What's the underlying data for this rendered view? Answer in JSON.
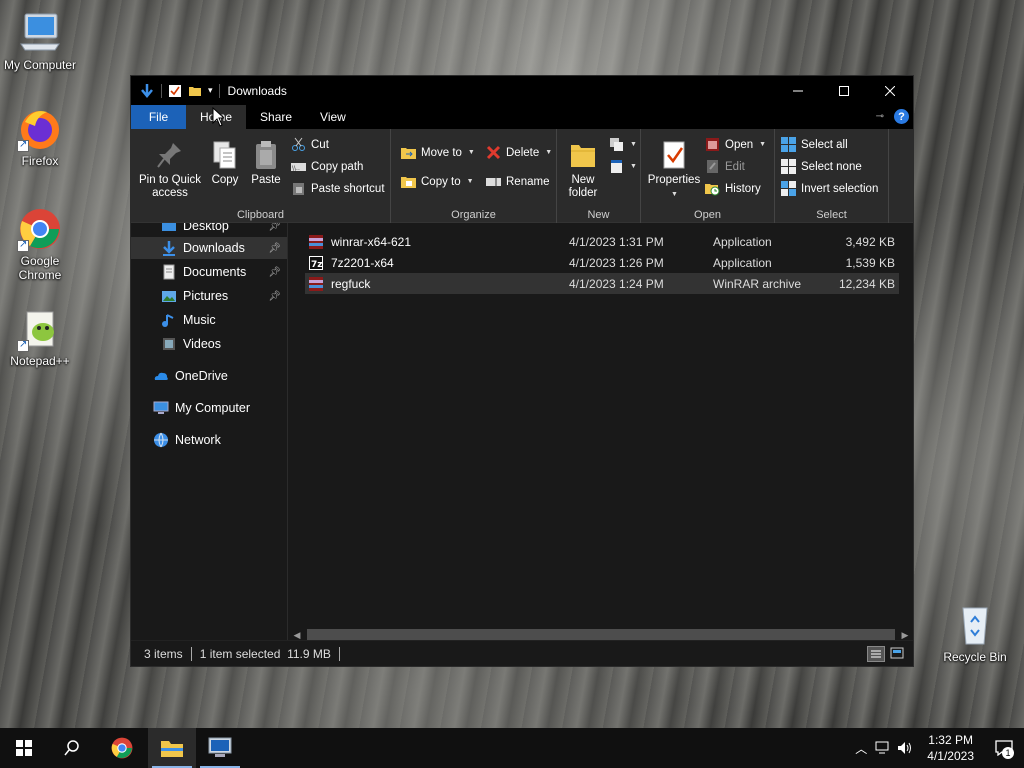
{
  "desktop": {
    "icons": [
      {
        "label": "My Computer",
        "icon": "computer-icon"
      },
      {
        "label": "Firefox",
        "icon": "firefox-icon"
      },
      {
        "label": "Google Chrome",
        "icon": "chrome-icon"
      },
      {
        "label": "Notepad++",
        "icon": "notepadpp-icon"
      },
      {
        "label": "Recycle Bin",
        "icon": "recycle-bin-icon"
      }
    ]
  },
  "window": {
    "title": "Downloads",
    "tabs": [
      {
        "label": "File"
      },
      {
        "label": "Home"
      },
      {
        "label": "Share"
      },
      {
        "label": "View"
      }
    ],
    "ribbon": {
      "clipboard": {
        "label": "Clipboard",
        "pin": "Pin to Quick access",
        "copy": "Copy",
        "paste": "Paste",
        "cut": "Cut",
        "copy_path": "Copy path",
        "paste_shortcut": "Paste shortcut"
      },
      "organize": {
        "label": "Organize",
        "move_to": "Move to",
        "copy_to": "Copy to",
        "delete": "Delete",
        "rename": "Rename"
      },
      "new": {
        "label": "New",
        "new_folder": "New folder"
      },
      "open": {
        "label": "Open",
        "properties": "Properties",
        "open": "Open",
        "edit": "Edit",
        "history": "History"
      },
      "select": {
        "label": "Select",
        "select_all": "Select all",
        "select_none": "Select none",
        "invert": "Invert selection"
      }
    },
    "nav": {
      "items": [
        {
          "label": "Desktop",
          "pinned": true
        },
        {
          "label": "Downloads",
          "pinned": true,
          "selected": true
        },
        {
          "label": "Documents",
          "pinned": true
        },
        {
          "label": "Pictures",
          "pinned": true
        },
        {
          "label": "Music"
        },
        {
          "label": "Videos"
        },
        {
          "label": "OneDrive"
        },
        {
          "label": "My Computer"
        },
        {
          "label": "Network"
        }
      ]
    },
    "files": [
      {
        "name": "winrar-x64-621",
        "date": "4/1/2023 1:31 PM",
        "type": "Application",
        "size": "3,492 KB"
      },
      {
        "name": "7z2201-x64",
        "date": "4/1/2023 1:26 PM",
        "type": "Application",
        "size": "1,539 KB"
      },
      {
        "name": "regfuck",
        "date": "4/1/2023 1:24 PM",
        "type": "WinRAR archive",
        "size": "12,234 KB",
        "selected": true
      }
    ],
    "status": {
      "count": "3 items",
      "selection": "1 item selected  11.9 MB"
    }
  },
  "taskbar": {
    "time": "1:32 PM",
    "date": "4/1/2023",
    "notification_count": "1"
  },
  "colors": {
    "accent": "#1c62b8",
    "window_bg": "#191919",
    "ribbon_bg": "#2b2b2b"
  }
}
